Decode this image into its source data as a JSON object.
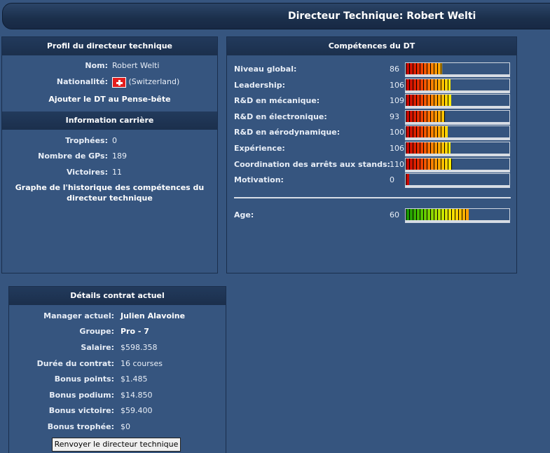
{
  "header": {
    "title": "Directeur Technique: Robert Welti"
  },
  "profile": {
    "title": "Profil du directeur technique",
    "name_label": "Nom:",
    "name_value": "Robert Welti",
    "nationality_label": "Nationalité:",
    "nationality_value": "(Switzerland)",
    "flag_icon": "switzerland-flag-icon",
    "add_link": "Ajouter le DT au Pense-bête"
  },
  "career": {
    "title": "Information carrière",
    "trophies_label": "Trophées:",
    "trophies_value": "0",
    "gps_label": "Nombre de GPs:",
    "gps_value": "189",
    "wins_label": "Victoires:",
    "wins_value": "11",
    "graph_link": "Graphe de l'historique des compétences du directeur technique"
  },
  "skills": {
    "title": "Compétences du DT",
    "items": [
      {
        "label": "Niveau global:",
        "value": "86",
        "level": 86
      },
      {
        "label": "Leadership:",
        "value": "106",
        "level": 106
      },
      {
        "label": "R&D en mécanique:",
        "value": "109",
        "level": 109
      },
      {
        "label": "R&D en électronique:",
        "value": "93",
        "level": 93
      },
      {
        "label": "R&D en aérodynamique:",
        "value": "100",
        "level": 100
      },
      {
        "label": "Expérience:",
        "value": "106",
        "level": 106
      },
      {
        "label": "Coordination des arrêts aux stands:",
        "value": "110",
        "level": 110
      },
      {
        "label": "Motivation:",
        "value": "0",
        "level": 0
      }
    ],
    "age_label": "Age:",
    "age_value": "60",
    "age_level": 60
  },
  "contract": {
    "title": "Détails contrat actuel",
    "manager_label": "Manager actuel:",
    "manager_value": "Julien Alavoine",
    "group_label": "Groupe:",
    "group_value": "Pro - 7",
    "salary_label": "Salaire:",
    "salary_value": "$598.358",
    "duration_label": "Durée du contrat:",
    "duration_value": "16 courses",
    "bonus_points_label": "Bonus points:",
    "bonus_points_value": "$1.485",
    "bonus_podium_label": "Bonus podium:",
    "bonus_podium_value": "$14.850",
    "bonus_win_label": "Bonus victoire:",
    "bonus_win_value": "$59.400",
    "bonus_trophy_label": "Bonus trophée:",
    "bonus_trophy_value": "$0",
    "fire_button": "Renvoyer le directeur technique"
  },
  "colors": {
    "background": "#36557f",
    "header_dark": "#1b2f4c",
    "border": "#1a2e4c"
  }
}
